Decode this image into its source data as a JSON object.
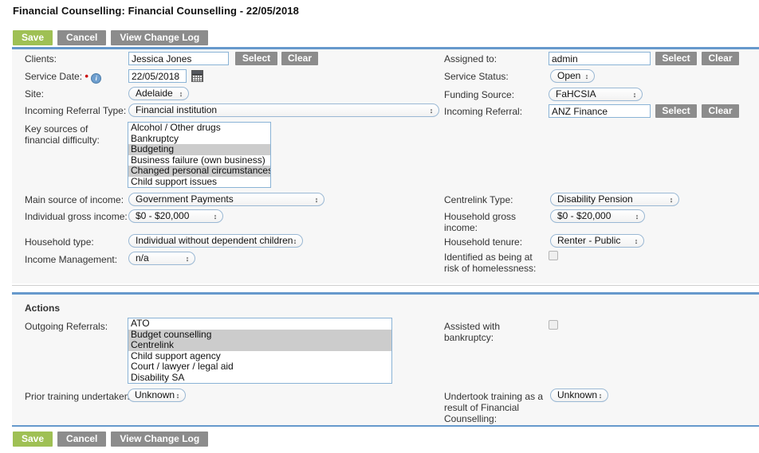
{
  "page": {
    "title": "Financial Counselling: Financial Counselling - 22/05/2018"
  },
  "toolbar": {
    "save_label": "Save",
    "cancel_label": "Cancel",
    "changelog_label": "View Change Log"
  },
  "colors": {
    "save_green": "#9fc054",
    "grey_button": "#8c8c8c",
    "accent_rule": "#6699cc",
    "panel_bg": "#f7f7f7",
    "selected_option": "#cccccc",
    "required_star": "#cc0000"
  },
  "form": {
    "clients": {
      "label": "Clients:",
      "value": "Jessica Jones",
      "select_label": "Select",
      "clear_label": "Clear"
    },
    "service_date": {
      "label": "Service Date:",
      "required_marker": "•",
      "info_glyph": "i",
      "value": "22/05/2018"
    },
    "site": {
      "label": "Site:",
      "value": "Adelaide"
    },
    "incoming_referral_type": {
      "label": "Incoming Referral Type:",
      "value": "Financial institution"
    },
    "key_sources": {
      "label": "Key sources of financial difficulty:",
      "options": [
        {
          "text": "Alcohol / Other drugs",
          "selected": false
        },
        {
          "text": "Bankruptcy",
          "selected": false
        },
        {
          "text": "Budgeting",
          "selected": true
        },
        {
          "text": "Business failure (own business)",
          "selected": false
        },
        {
          "text": "Changed personal circumstances",
          "selected": true
        },
        {
          "text": "Child support issues",
          "selected": false
        }
      ]
    },
    "main_source_income": {
      "label": "Main source of income:",
      "value": "Government Payments"
    },
    "individual_gross_income": {
      "label": "Individual gross income:",
      "value": "$0 - $20,000"
    },
    "household_type": {
      "label": "Household type:",
      "value": "Individual without dependent children"
    },
    "income_management": {
      "label": "Income Management:",
      "value": "n/a"
    },
    "assigned_to": {
      "label": "Assigned to:",
      "value": "admin",
      "select_label": "Select",
      "clear_label": "Clear"
    },
    "service_status": {
      "label": "Service Status:",
      "value": "Open"
    },
    "funding_source": {
      "label": "Funding Source:",
      "value": "FaHCSIA"
    },
    "incoming_referral": {
      "label": "Incoming Referral:",
      "value": "ANZ Finance",
      "select_label": "Select",
      "clear_label": "Clear"
    },
    "centrelink_type": {
      "label": "Centrelink Type:",
      "value": "Disability Pension"
    },
    "household_gross_income": {
      "label": "Household gross income:",
      "value": "$0 - $20,000"
    },
    "household_tenure": {
      "label": "Household tenure:",
      "value": "Renter - Public"
    },
    "at_risk_homelessness": {
      "label": "Identified as being at risk of homelessness:",
      "checked": false
    }
  },
  "actions": {
    "heading": "Actions",
    "outgoing_referrals": {
      "label": "Outgoing Referrals:",
      "options": [
        {
          "text": "ATO",
          "selected": false
        },
        {
          "text": "Budget counselling",
          "selected": true
        },
        {
          "text": "Centrelink",
          "selected": true
        },
        {
          "text": "Child support agency",
          "selected": false
        },
        {
          "text": "Court / lawyer / legal aid",
          "selected": false
        },
        {
          "text": "Disability SA",
          "selected": false
        }
      ]
    },
    "prior_training": {
      "label": "Prior training undertaken:",
      "value": "Unknown"
    },
    "assisted_bankruptcy": {
      "label": "Assisted with bankruptcy:",
      "checked": false
    },
    "undertook_training": {
      "label": "Undertook training as a result of Financial Counselling:",
      "value": "Unknown"
    }
  },
  "bottom_toolbar": {
    "save_label": "Save",
    "cancel_label": "Cancel",
    "changelog_label": "View Change Log"
  }
}
